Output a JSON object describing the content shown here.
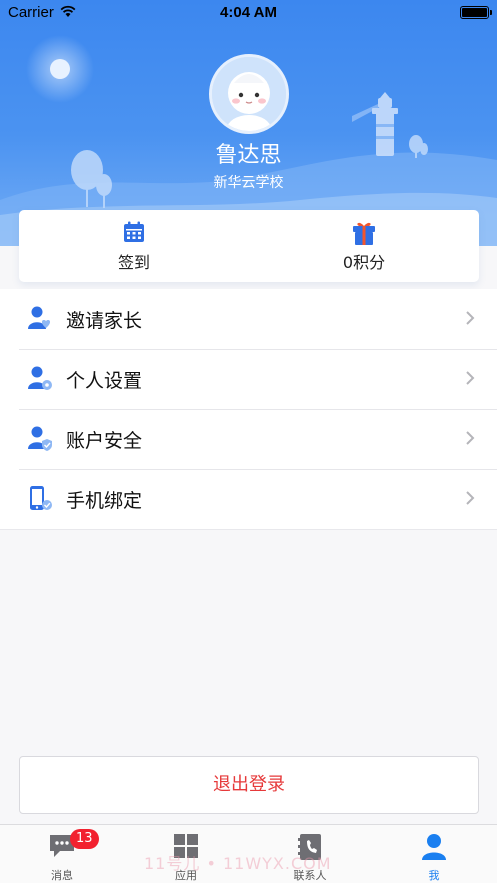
{
  "status_bar": {
    "carrier": "Carrier",
    "time": "4:04 AM"
  },
  "profile": {
    "name": "鲁达思",
    "school": "新华云学校"
  },
  "quick_actions": [
    {
      "label": "签到",
      "icon": "calendar-icon"
    },
    {
      "label": "0积分",
      "icon": "gift-icon"
    }
  ],
  "menu": [
    {
      "label": "邀请家长",
      "icon": "invite-parent-icon"
    },
    {
      "label": "个人设置",
      "icon": "user-settings-icon"
    },
    {
      "label": "账户安全",
      "icon": "account-security-icon"
    },
    {
      "label": "手机绑定",
      "icon": "phone-binding-icon"
    }
  ],
  "logout_label": "退出登录",
  "tabs": [
    {
      "label": "消息",
      "icon": "message-icon",
      "badge": "13",
      "active": false
    },
    {
      "label": "应用",
      "icon": "apps-grid-icon",
      "active": false
    },
    {
      "label": "联系人",
      "icon": "contacts-icon",
      "active": false
    },
    {
      "label": "我",
      "icon": "me-icon",
      "active": true
    }
  ],
  "watermark": "11号儿 • 11WYX.COM",
  "colors": {
    "primary": "#3c87ef",
    "active_tab": "#1a7ff0",
    "logout_text": "#e6393a",
    "badge": "#f2212f"
  }
}
